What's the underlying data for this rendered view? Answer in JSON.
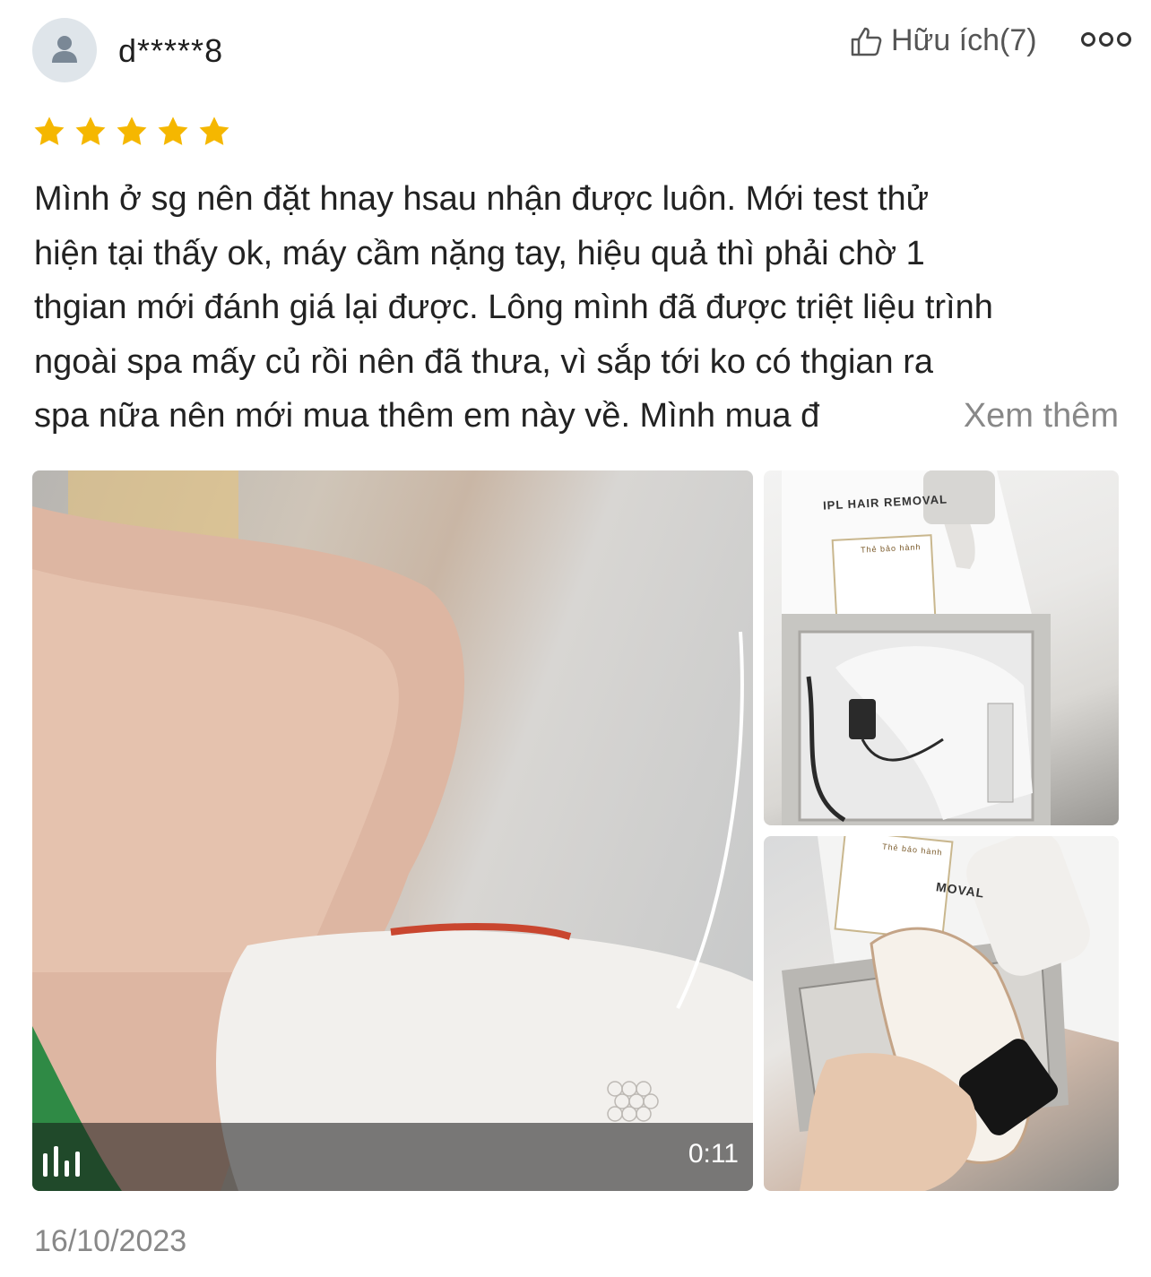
{
  "reviewer": {
    "name": "d*****8",
    "avatar_icon": "user-icon"
  },
  "helpful": {
    "label": "Hữu ích(7)",
    "icon": "thumbs-up-icon"
  },
  "more_icon": "more-options-icon",
  "rating": {
    "stars": 5,
    "max": 5,
    "color": "#f5b700"
  },
  "review": {
    "lines": [
      "Mình ở sg nên đặt hnay hsau nhận được luôn. Mới test thử",
      "hiện tại thấy ok, máy cầm nặng tay, hiệu quả thì phải chờ 1",
      "thgian mới đánh giá lại được. Lông mình đã được triệt liệu trình",
      "ngoài spa mấy củ rồi nên đã thưa, vì sắp tới ko có thgian ra"
    ],
    "last_line": "spa nữa nên mới mua thêm em này về. Mình mua đ",
    "see_more": "Xem thêm"
  },
  "media": {
    "video": {
      "duration": "0:11",
      "icon": "audio-bars-icon"
    },
    "photo1_text": "IPL HAIR REMOVAL",
    "photo2_text": "MOVAL",
    "card_text": "Thẻ bảo hành"
  },
  "date": "16/10/2023"
}
